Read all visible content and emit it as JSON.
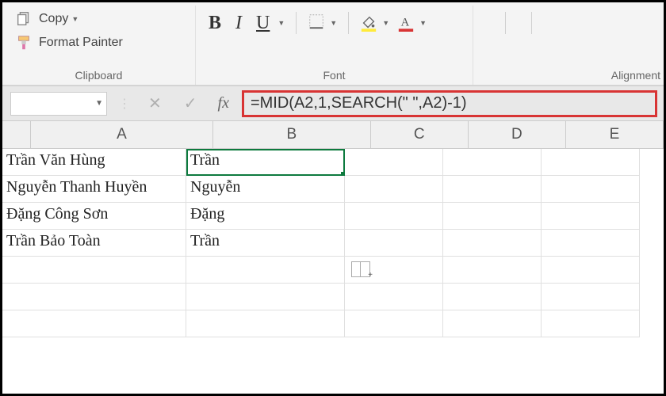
{
  "ribbon": {
    "clipboard": {
      "copy_label": "Copy",
      "format_painter_label": "Format Painter",
      "group_label": "Clipboard"
    },
    "font": {
      "bold": "B",
      "italic": "I",
      "underline": "U",
      "group_label": "Font"
    },
    "alignment": {
      "group_label": "Alignment"
    }
  },
  "formula_bar": {
    "fx": "fx",
    "formula": "=MID(A2,1,SEARCH(\" \",A2)-1)"
  },
  "columns": [
    "A",
    "B",
    "C",
    "D",
    "E"
  ],
  "cells": {
    "A2": "Trần Văn Hùng",
    "B2": "Trần",
    "A3": "Nguyễn Thanh Huyền",
    "B3": "Nguyễn",
    "A4": "Đặng Công Sơn",
    "B4": "Đặng",
    "A5": "Trần Bảo Toàn",
    "B5": "Trần"
  },
  "selected_cell": "B2"
}
